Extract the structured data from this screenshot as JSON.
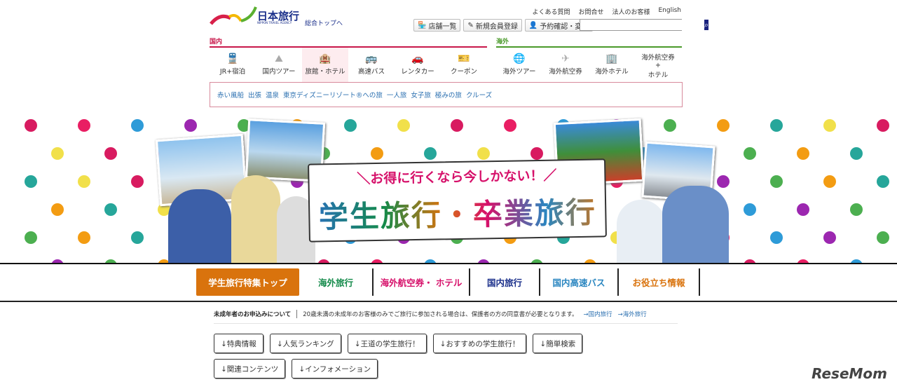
{
  "header": {
    "logo_text": "日本旅行",
    "logo_sub": "NIPPON TRAVEL AGENCY",
    "top_link": "総合トップへ",
    "util_links": [
      "よくある質問",
      "お問合せ",
      "法人のお客様",
      "English"
    ],
    "tools": [
      "店舗一覧",
      "新規会員登録",
      "予約確認・変更"
    ],
    "search_placeholder": ""
  },
  "nav": {
    "domestic_label": "国内",
    "overseas_label": "海外",
    "domestic": [
      {
        "label": "JR+宿泊",
        "icon": "train-icon"
      },
      {
        "label": "国内ツアー",
        "icon": "japan-map-icon"
      },
      {
        "label": "旅館・ホテル",
        "icon": "hotel-icon"
      },
      {
        "label": "高速バス",
        "icon": "bus-icon"
      },
      {
        "label": "レンタカー",
        "icon": "car-icon"
      },
      {
        "label": "クーポン",
        "icon": "coupon-icon"
      }
    ],
    "overseas": [
      {
        "label": "海外ツアー",
        "icon": "globe-icon"
      },
      {
        "label": "海外航空券",
        "icon": "plane-icon"
      },
      {
        "label": "海外ホテル",
        "icon": "building-icon"
      },
      {
        "label": "海外航空券\n+\nホテル",
        "icon": ""
      }
    ],
    "sub_links": [
      "赤い風船",
      "出張",
      "温泉",
      "東京ディズニーリゾート®への旅",
      "一人旅",
      "女子旅",
      "極みの旅",
      "クルーズ"
    ]
  },
  "banner": {
    "subtitle": "＼お得に行くなら今しかない！／",
    "title": "学生旅行・卒業旅行"
  },
  "tabs": [
    {
      "label": "学生旅行特集トップ",
      "color": "#ffffff"
    },
    {
      "label": "海外旅行",
      "color": "#138a4a"
    },
    {
      "label": "海外航空券・ ホテル",
      "color": "#d6106a"
    },
    {
      "label": "国内旅行",
      "color": "#1a2f8a"
    },
    {
      "label": "国内高速バス",
      "color": "#2a86c0"
    },
    {
      "label": "お役立ち情報",
      "color": "#d9730d"
    }
  ],
  "notice": {
    "heading": "未成年者のお申込みについて",
    "text": "20歳未満の未成年のお客様のみでご旅行に参加される場合は、保護者の方の同意書が必要となります。",
    "links": [
      "→国内旅行",
      "→海外旅行"
    ]
  },
  "jump_buttons": [
    "↓特典情報",
    "↓人気ランキング",
    "↓王道の学生旅行！",
    "↓おすすめの学生旅行！",
    "↓簡単検索",
    "↓関連コンテンツ",
    "↓インフォメーション"
  ],
  "watermark": "ReseMom"
}
